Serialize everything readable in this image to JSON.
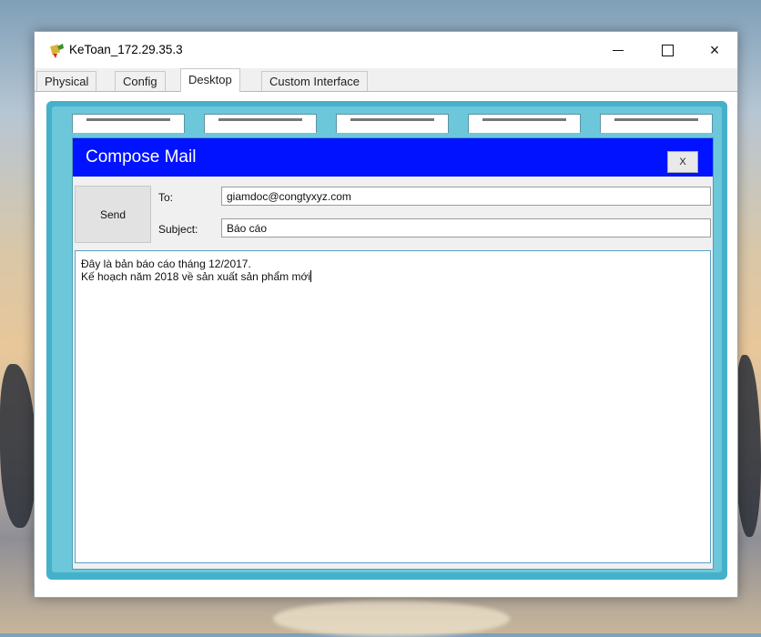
{
  "window": {
    "title": "KeToan_172.29.35.3",
    "controls": {
      "minimize": "minimize",
      "maximize": "maximize",
      "close": "×"
    }
  },
  "tabs": [
    {
      "label": "Physical"
    },
    {
      "label": "Config"
    },
    {
      "label": "Desktop",
      "active": true
    },
    {
      "label": "Custom Interface"
    }
  ],
  "compose": {
    "title": "Compose Mail",
    "close_label": "X",
    "send_label": "Send",
    "to_label": "To:",
    "to_value": "giamdoc@congtyxyz.com",
    "subject_label": "Subject:",
    "subject_value": "Báo cáo",
    "body_lines": [
      "Đây là bản báo cáo tháng 12/2017.",
      "Kế hoạch năm 2018 về sản xuất sản phẩm mới"
    ]
  },
  "colors": {
    "compose_header": "#0012ff",
    "desktop_frame": "#45b0c9",
    "desktop_inner": "#6cc7da"
  },
  "icons": {
    "app": "packet-tracer-pc-icon",
    "minimize": "minimize-icon",
    "maximize": "maximize-icon",
    "close": "close-icon"
  }
}
